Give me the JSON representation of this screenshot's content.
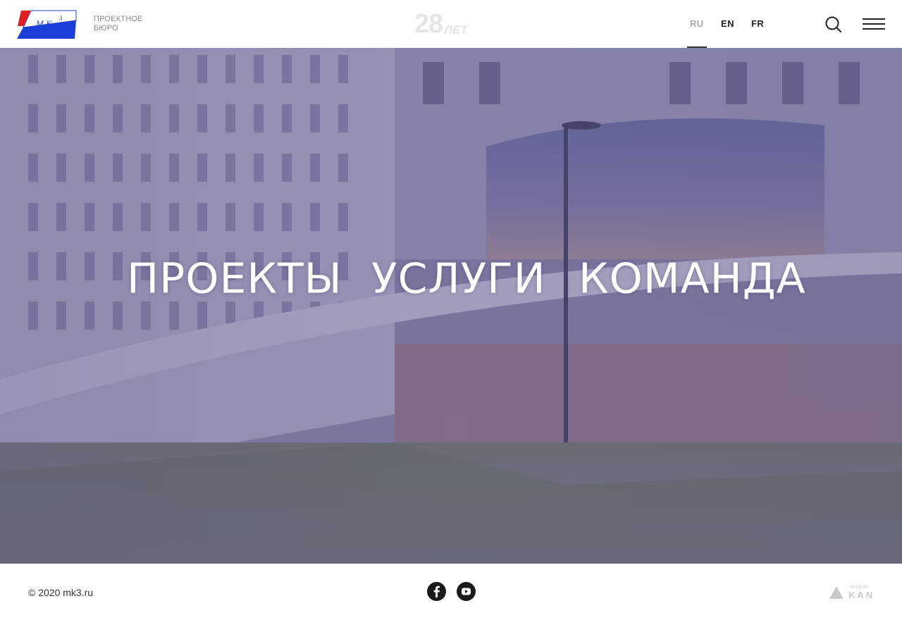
{
  "header": {
    "logo_text": "M.K.",
    "logo_superscript": "3",
    "logo_subtitle_line1": "ПРОЕКТНОЕ",
    "logo_subtitle_line2": "БЮРО",
    "anniversary_number": "28",
    "anniversary_word": "ЛЕТ",
    "languages": [
      {
        "label": "RU",
        "active": true
      },
      {
        "label": "EN",
        "active": false
      },
      {
        "label": "FR",
        "active": false
      }
    ]
  },
  "hero": {
    "nav": [
      {
        "label": "ПРОЕКТЫ"
      },
      {
        "label": "УСЛУГИ"
      },
      {
        "label": "КОМАНДА"
      }
    ]
  },
  "footer": {
    "copyright": "© 2020 mk3.ru",
    "social": [
      {
        "icon": "facebook-icon"
      },
      {
        "icon": "youtube-icon"
      }
    ],
    "made_by_small": "MADE BY",
    "made_by_brand": "KAN"
  },
  "colors": {
    "logo_red": "#e02020",
    "logo_blue": "#1c3fd8",
    "hero_overlay": "#6a5f9c",
    "text_dark": "#222222"
  }
}
